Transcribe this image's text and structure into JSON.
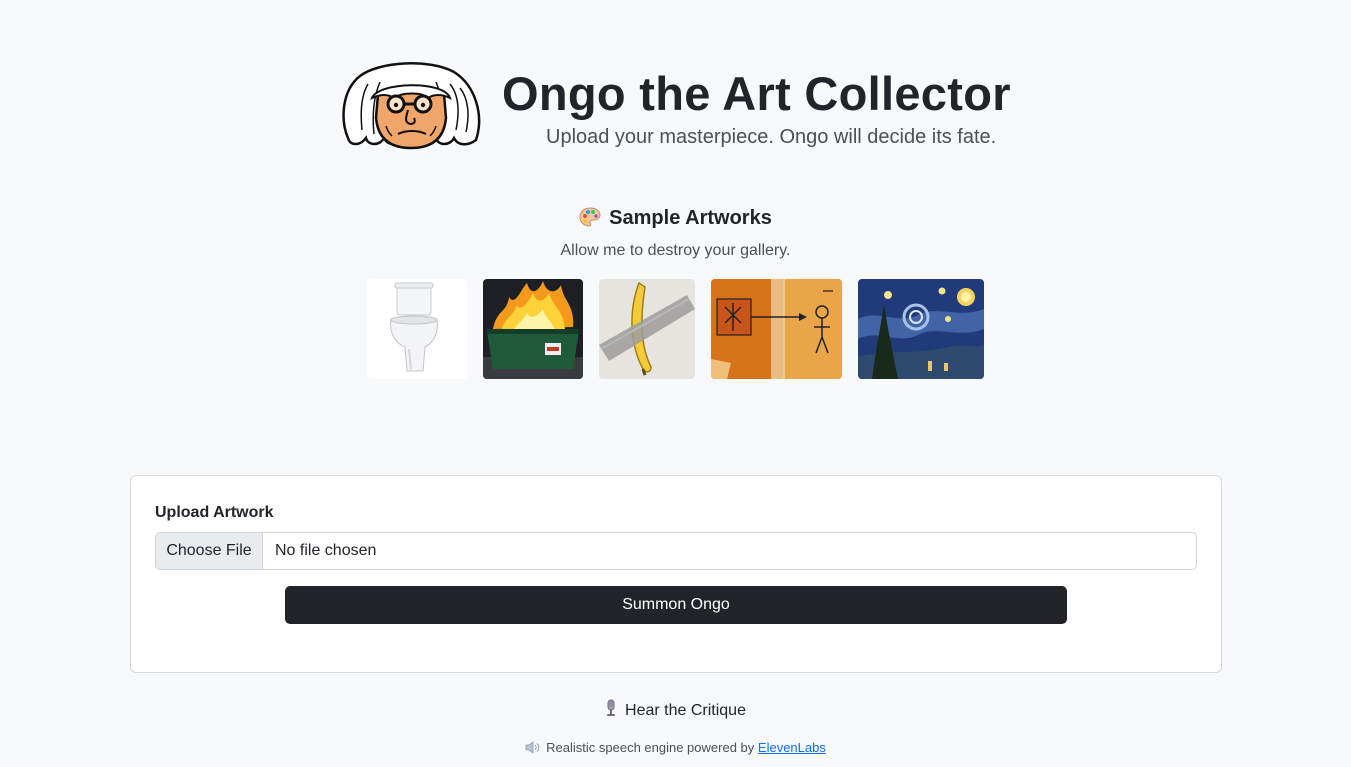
{
  "header": {
    "title": "Ongo the Art Collector",
    "subtitle": "Upload your masterpiece. Ongo will decide its fate.",
    "logo_icon": "ongo-avatar-icon"
  },
  "samples": {
    "heading": "Sample Artworks",
    "heading_icon": "palette-icon",
    "subheading": "Allow me to destroy your gallery.",
    "items": [
      {
        "name": "toilet",
        "icon": "toilet-image"
      },
      {
        "name": "dumpster-fire",
        "icon": "dumpster-fire-image"
      },
      {
        "name": "taped-banana",
        "icon": "banana-image"
      },
      {
        "name": "balloon-girl-mural",
        "icon": "mural-image"
      },
      {
        "name": "starry-night",
        "icon": "starry-night-image"
      }
    ]
  },
  "upload": {
    "label": "Upload Artwork",
    "choose_file": "Choose File",
    "status": "No file chosen",
    "submit": "Summon Ongo"
  },
  "audio": {
    "heading": "Hear the Critique",
    "heading_icon": "microphone-icon",
    "powered_prefix": "Realistic speech engine powered by",
    "powered_link": "ElevenLabs",
    "powered_icon": "speaker-icon"
  },
  "colors": {
    "background": "#f8f9fa",
    "primary_button": "#212529",
    "link": "#0d6efd"
  }
}
